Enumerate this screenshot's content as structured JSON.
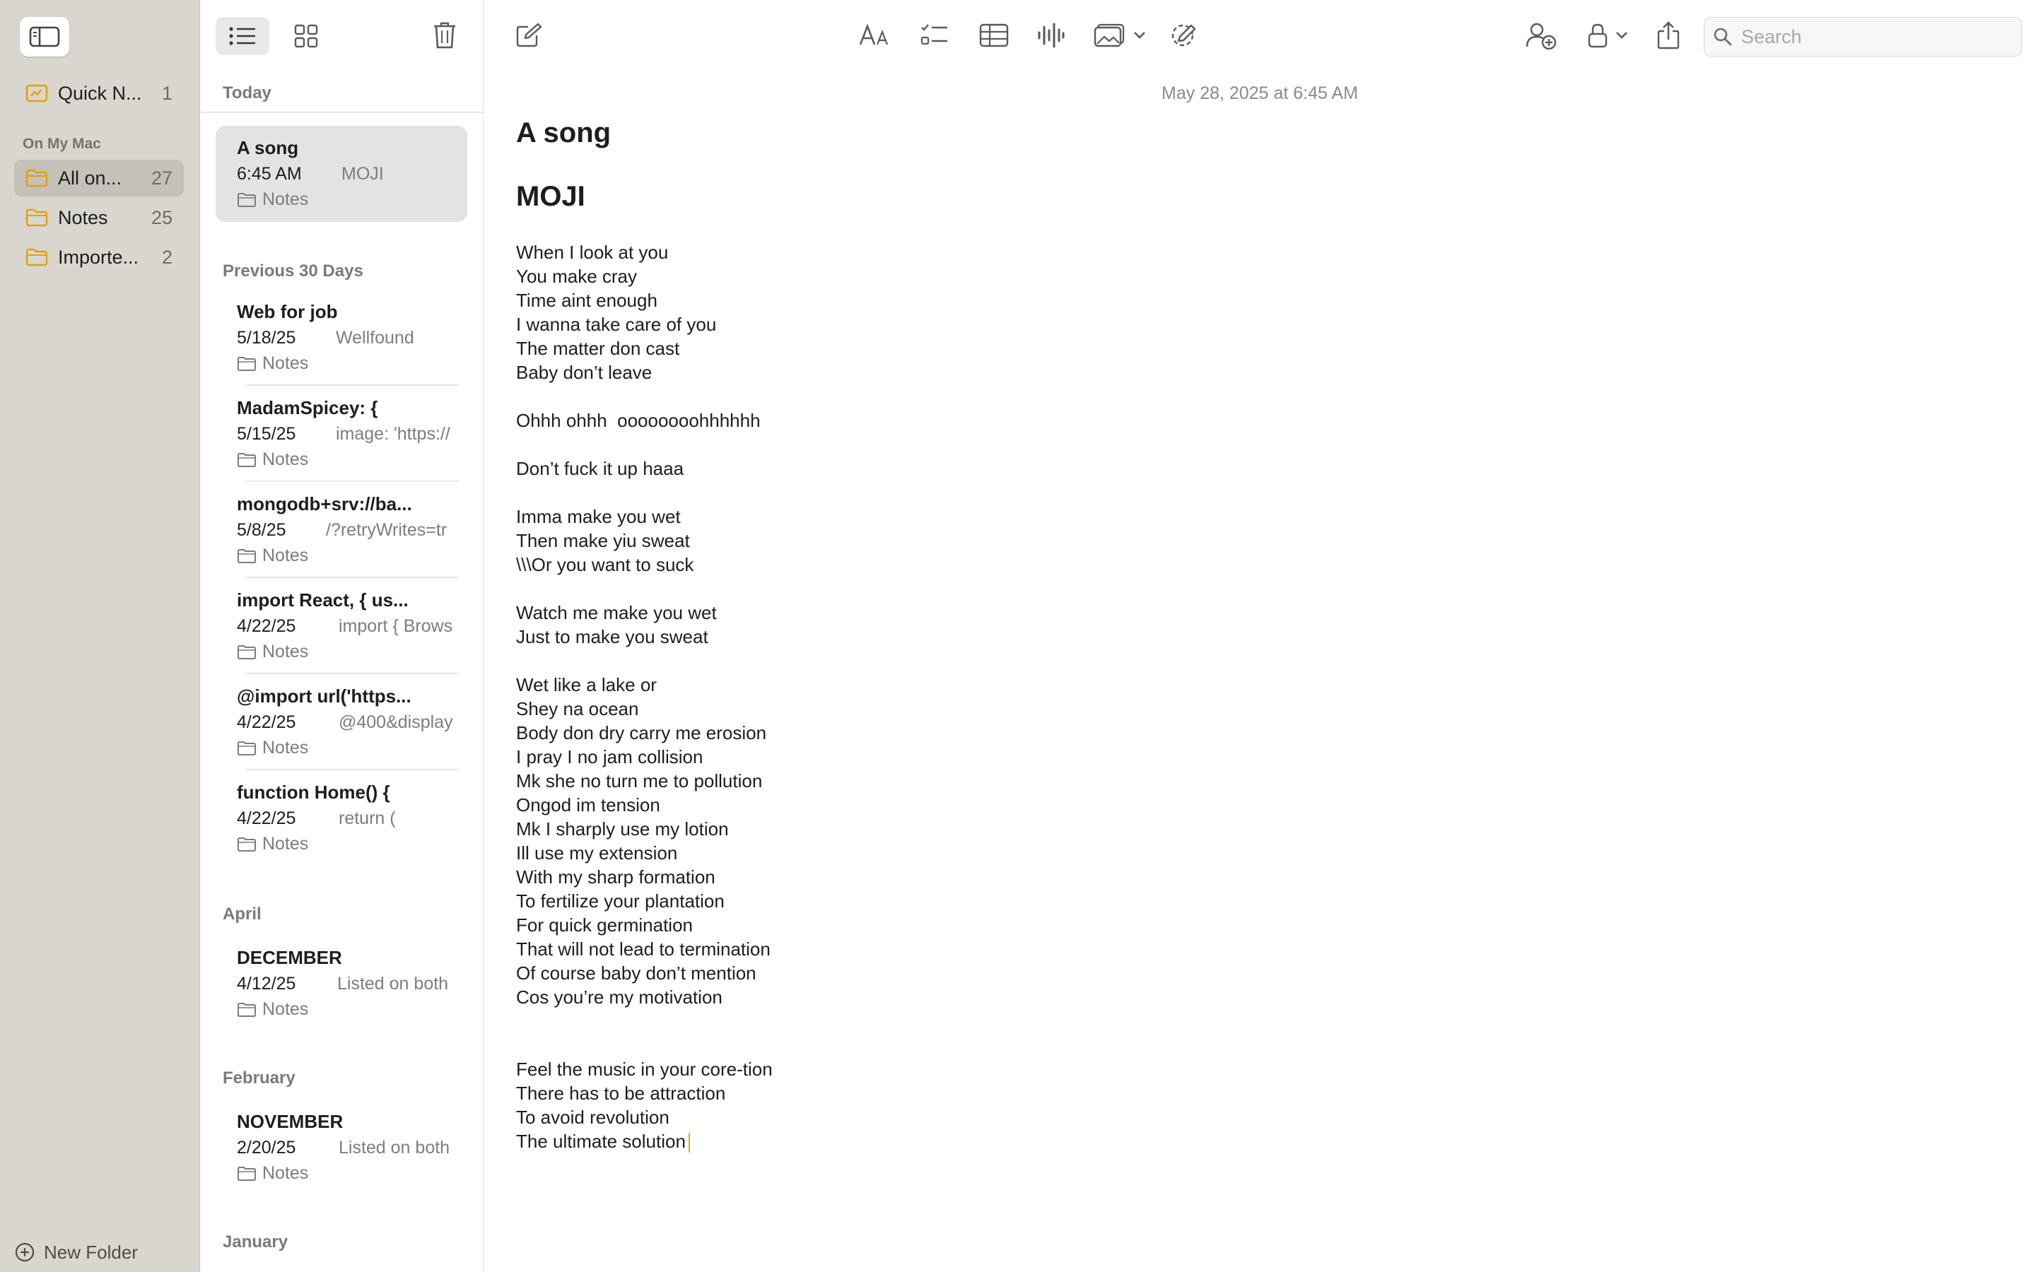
{
  "sidebar": {
    "quick_notes": {
      "label": "Quick N...",
      "count": "1"
    },
    "section_label": "On My Mac",
    "folders": [
      {
        "label": "All on...",
        "count": "27"
      },
      {
        "label": "Notes",
        "count": "25"
      },
      {
        "label": "Importe...",
        "count": "2"
      }
    ],
    "new_folder_label": "New Folder"
  },
  "note_list": {
    "sections": [
      "Today",
      "Previous 30 Days",
      "April",
      "February",
      "January"
    ],
    "notes": [
      {
        "title": "A song",
        "date": "6:45 AM",
        "preview": "MOJI",
        "folder": "Notes"
      },
      {
        "title": "Web for job",
        "date": "5/18/25",
        "preview": "Wellfound",
        "folder": "Notes"
      },
      {
        "title": "MadamSpicey: {",
        "date": "5/15/25",
        "preview": "image: 'https://",
        "folder": "Notes"
      },
      {
        "title": "mongodb+srv://ba...",
        "date": "5/8/25",
        "preview": "/?retryWrites=tr",
        "folder": "Notes"
      },
      {
        "title": "import React, { us...",
        "date": "4/22/25",
        "preview": "import { Brows",
        "folder": "Notes"
      },
      {
        "title": "@import url('https...",
        "date": "4/22/25",
        "preview": "@400&display",
        "folder": "Notes"
      },
      {
        "title": "function Home() {",
        "date": "4/22/25",
        "preview": "return (",
        "folder": "Notes"
      },
      {
        "title": "DECEMBER",
        "date": "4/12/25",
        "preview": "Listed on both",
        "folder": "Notes"
      },
      {
        "title": "NOVEMBER",
        "date": "2/20/25",
        "preview": "Listed on both",
        "folder": "Notes"
      }
    ]
  },
  "editor": {
    "search_placeholder": "Search",
    "date": "May 28, 2025 at 6:45 AM",
    "title": "A song",
    "heading": "MOJI",
    "lines": [
      "When I look at you",
      "You make cray",
      "Time aint enough",
      "I wanna take care of you",
      "The matter don cast",
      "Baby don’t leave",
      "",
      "Ohhh ohhh  oooooooohhhhhh",
      "",
      "Don’t fuck it up haaa",
      "",
      "Imma make you wet",
      "Then make yiu sweat",
      "\\\\\\Or you want to suck",
      "",
      "Watch me make you wet",
      "Just to make you sweat",
      "",
      "Wet like a lake or",
      "Shey na ocean",
      "Body don dry carry me erosion",
      "I pray I no jam collision",
      "Mk she no turn me to pollution",
      "Ongod im tension",
      "Mk I sharply use my lotion",
      "Ill use my extension",
      "With my sharp formation",
      "To fertilize your plantation",
      "For quick germination",
      "That will not lead to termination",
      "Of course baby don’t mention",
      "Cos you’re my motivation",
      "",
      "",
      "Feel the music in your core-tion",
      "There has to be attraction",
      "To avoid revolution",
      "The ultimate solution"
    ]
  },
  "icons": {
    "sidebar_toggle": "sidebar-toggle-icon",
    "folder": "folder-icon",
    "quick_note": "quick-note-icon",
    "list_view": "list-icon",
    "gallery_view": "grid-icon",
    "trash": "trash-icon",
    "compose": "compose-icon",
    "format": "text-format-icon",
    "checklist": "checklist-icon",
    "table": "table-icon",
    "audio": "waveform-icon",
    "media": "photo-icon",
    "markup": "markup-icon",
    "collaborate": "collaborate-icon",
    "lock": "lock-icon",
    "share": "share-icon",
    "search": "search-icon"
  },
  "colors": {
    "accent_folder": "#e3a008",
    "sidebar_bg": "#d9d6cf",
    "selected_note": "#e3e3e3",
    "caret": "#e0b100"
  }
}
